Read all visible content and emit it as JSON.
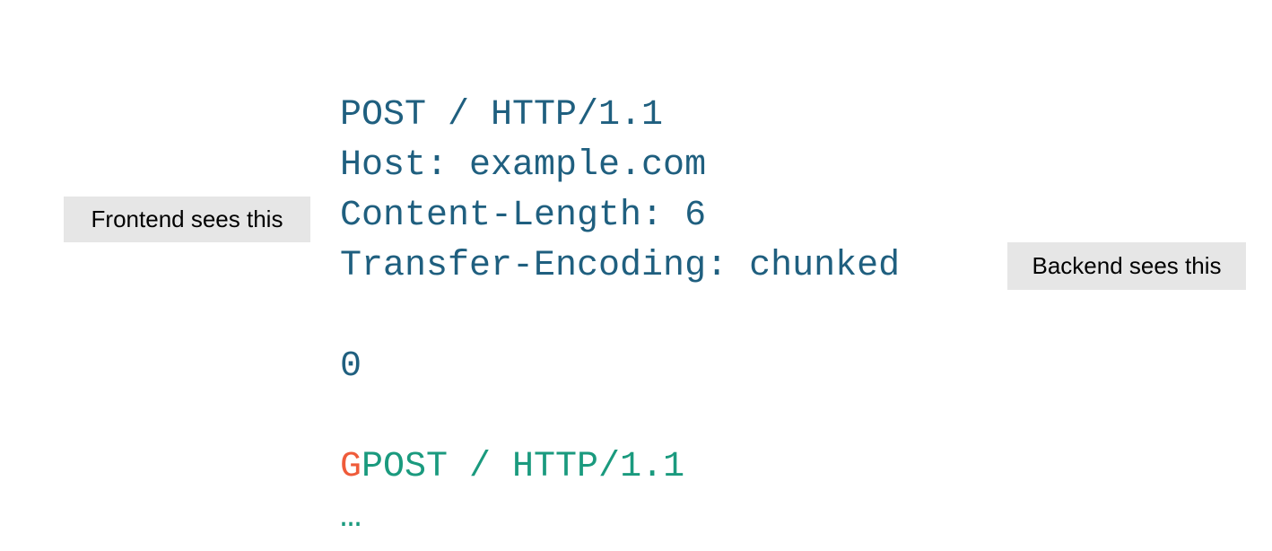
{
  "request": {
    "line1": "POST / HTTP/1.1",
    "line2": "Host: example.com",
    "line3": "Content-Length: 6",
    "line4": "Transfer-Encoding: chunked",
    "line5": "0",
    "smuggled_prefix": "G",
    "smuggled_rest": "POST / HTTP/1.1",
    "ellipsis": "…"
  },
  "labels": {
    "frontend": "Frontend sees this",
    "backend": "Backend sees this"
  },
  "colors": {
    "request_text": "#1f5f7f",
    "smuggled_text": "#1a9a7e",
    "smuggled_prefix": "#ef5b3a",
    "label_background": "#e6e6e6"
  }
}
